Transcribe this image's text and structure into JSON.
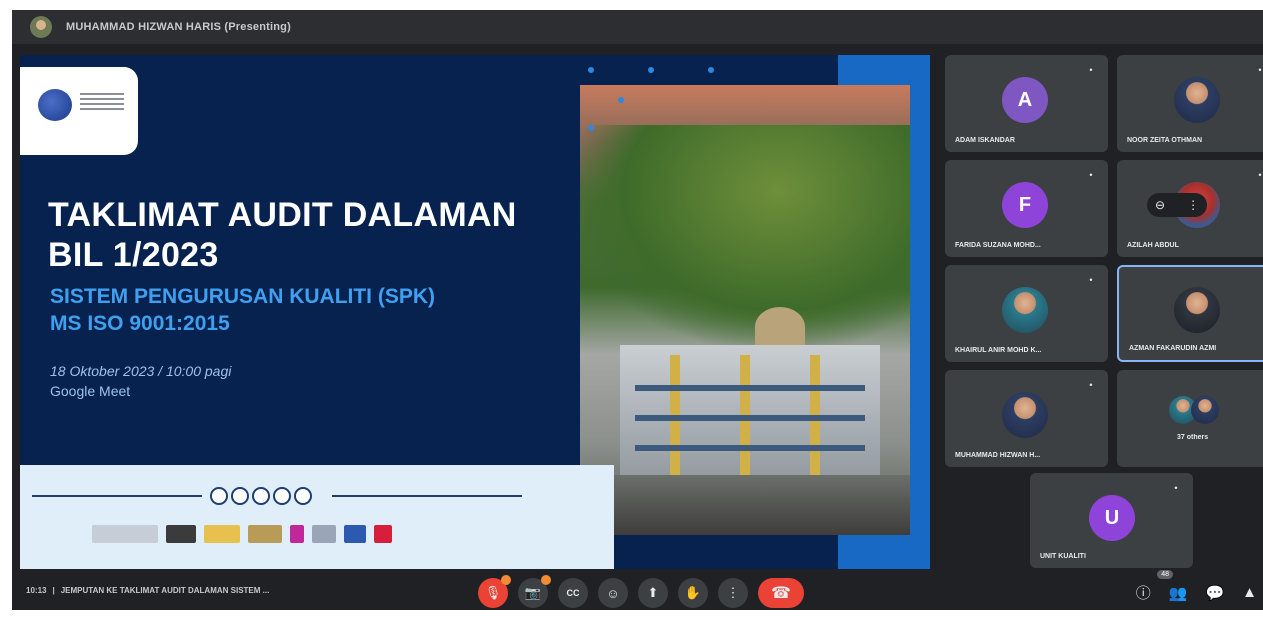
{
  "presenter": {
    "name": "MUHAMMAD HIZWAN HARIS (Presenting)",
    "icon": "presenter-avatar"
  },
  "slide": {
    "title_line1": "TAKLIMAT AUDIT DALAMAN",
    "title_line2": "BIL 1/2023",
    "subtitle_line1": "SISTEM PENGURUSAN KUALITI (SPK)",
    "subtitle_line2": "MS ISO 9001:2015",
    "date": "18 Oktober 2023 / 10:00 pagi",
    "venue": "Google Meet"
  },
  "participants": [
    {
      "initial": "A",
      "name": "ADAM ISKANDAR"
    },
    {
      "initial": "",
      "name": "NOOR ZEITA OTHMAN"
    },
    {
      "initial": "F",
      "name": "FARIDA SUZANA MOHD..."
    },
    {
      "initial": "",
      "name": "AZILAH ABDUL"
    },
    {
      "initial": "",
      "name": "KHAIRUL ANIR MOHD K..."
    },
    {
      "initial": "",
      "name": "AZMAN FAKARUDIN AZMI"
    },
    {
      "initial": "",
      "name": "MUHAMMAD HIZWAN H..."
    },
    {
      "initial": "",
      "name": "37 others"
    },
    {
      "initial": "U",
      "name": "UNIT KUALITI"
    }
  ],
  "meeting": {
    "time": "10:13",
    "separator": "|",
    "title": "JEMPUTAN KE TAKLIMAT AUDIT DALAMAN SISTEM ..."
  },
  "controls": {
    "mic": "🎙",
    "camera": "📷",
    "captions": "CC",
    "emoji": "☺",
    "present": "⬆",
    "hand": "✋",
    "more": "⋮",
    "leave": "☎"
  },
  "right_panel": {
    "info": "ⓘ",
    "people": "👥",
    "people_count": "48",
    "chat": "💬",
    "activities": "▲"
  },
  "more_pill": {
    "left": "⊖",
    "right": "⋮"
  }
}
